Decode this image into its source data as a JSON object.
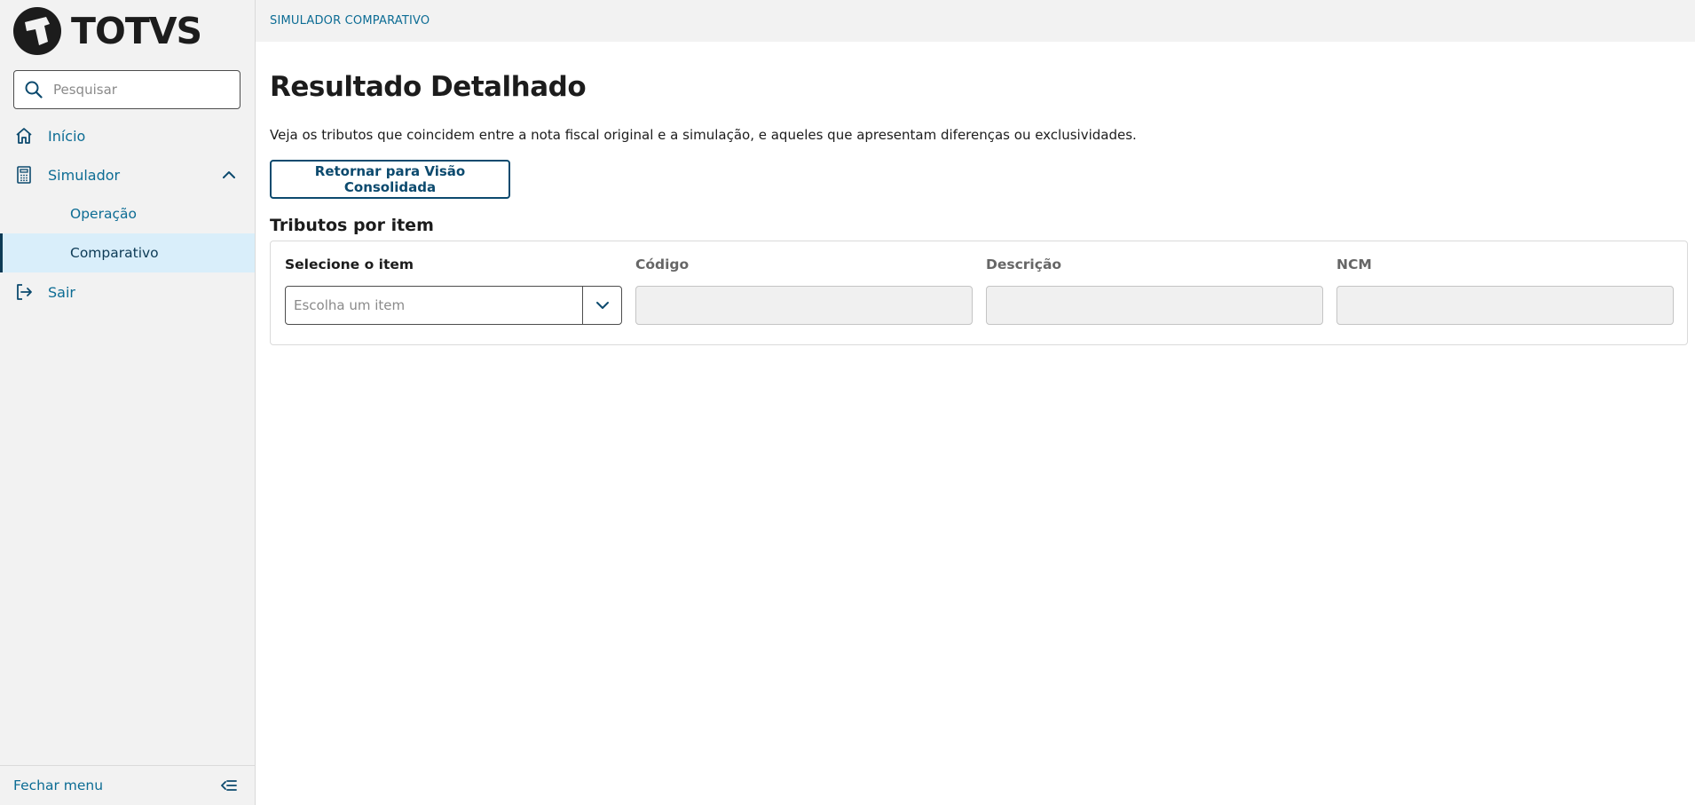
{
  "app": {
    "logo_text": "TOTVS"
  },
  "sidebar": {
    "search_placeholder": "Pesquisar",
    "items": [
      {
        "label": "Início",
        "icon": "home-icon"
      },
      {
        "label": "Simulador",
        "icon": "calculator-icon",
        "expanded": true,
        "children": [
          {
            "label": "Operação"
          },
          {
            "label": "Comparativo",
            "active": true
          }
        ]
      },
      {
        "label": "Sair",
        "icon": "logout-icon"
      }
    ],
    "footer_label": "Fechar menu"
  },
  "breadcrumb": "SIMULADOR COMPARATIVO",
  "main": {
    "title": "Resultado Detalhado",
    "description": "Veja os tributos que coincidem entre a nota fiscal original e a simulação, e aqueles que apresentam diferenças ou exclusividades.",
    "back_button": "Retornar para Visão Consolidada",
    "section_title": "Tributos por item",
    "fields": {
      "item_label": "Selecione o item",
      "item_placeholder": "Escolha um item",
      "code_label": "Código",
      "description_label": "Descrição",
      "ncm_label": "NCM"
    }
  },
  "colors": {
    "accent": "#0c6c94",
    "active_bg": "#d9eefa",
    "dark_blue": "#0c4a6e"
  }
}
